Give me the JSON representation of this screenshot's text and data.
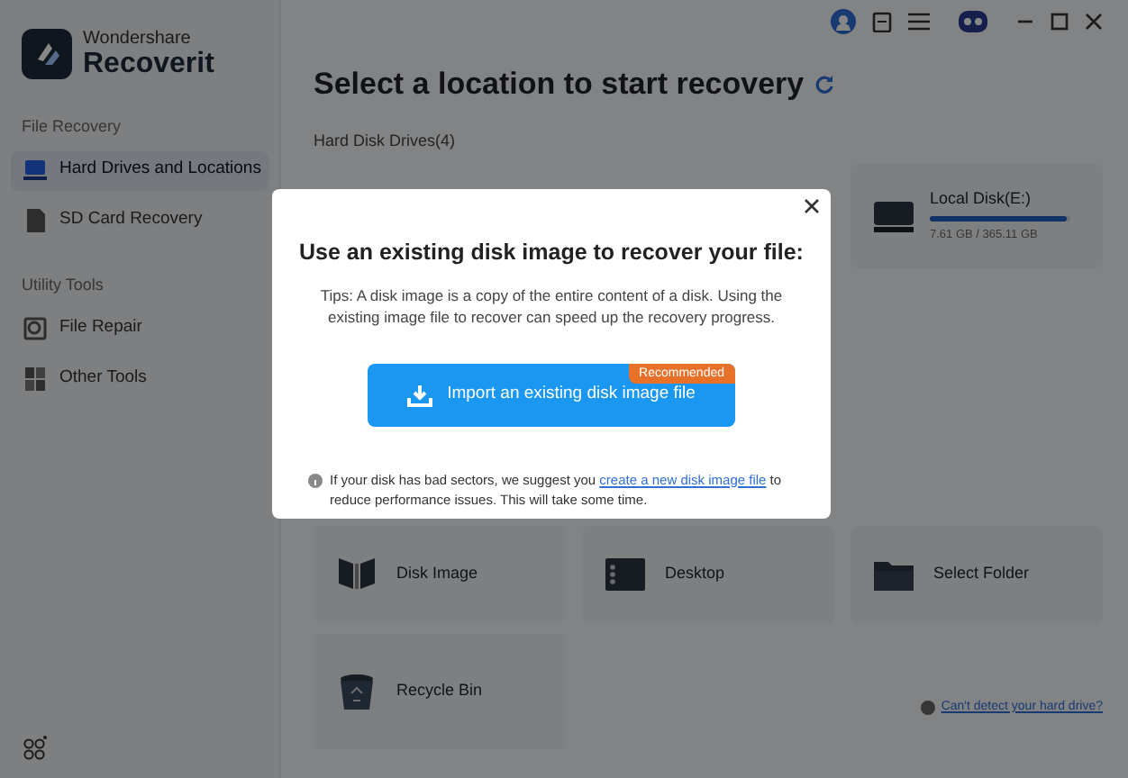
{
  "app": {
    "brand_top": "Wondershare",
    "brand_name": "Recoverit"
  },
  "sidebar": {
    "sections": [
      {
        "title": "File Recovery",
        "items": [
          {
            "label": "Hard Drives and Locations",
            "kind": "drive",
            "selected": true
          },
          {
            "label": "SD Card Recovery",
            "kind": "sd",
            "selected": false
          }
        ]
      },
      {
        "title": "Utility Tools",
        "items": [
          {
            "label": "File Repair",
            "kind": "repair",
            "selected": false
          },
          {
            "label": "Other Tools",
            "kind": "tools",
            "selected": false
          }
        ]
      }
    ]
  },
  "main": {
    "title": "Select a location to start recovery",
    "section_label": "Hard Disk Drives(4)",
    "drives": [
      {
        "name": "Local Disk(E:)",
        "level": 0.97,
        "size": "7.61 GB / 365.11 GB"
      }
    ],
    "locations": [
      {
        "label": "Disk Image",
        "kind": "disk-image"
      },
      {
        "label": "Desktop",
        "kind": "desktop"
      },
      {
        "label": "Select Folder",
        "kind": "folder"
      },
      {
        "label": "Recycle Bin",
        "kind": "recycle-bin"
      }
    ],
    "help_link": "Can't detect your hard drive?"
  },
  "dialog": {
    "title": "Use an existing disk image to recover your file:",
    "tips": "Tips: A disk image is a copy of the entire content of a disk. Using the existing image file to recover can speed up the recovery progress.",
    "button": "Import an existing disk image file",
    "badge": "Recommended",
    "note_before": "If your disk has bad sectors, we suggest you",
    "note_link": "create a new disk image file",
    "note_after": "to reduce performance issues. This will take some time."
  }
}
